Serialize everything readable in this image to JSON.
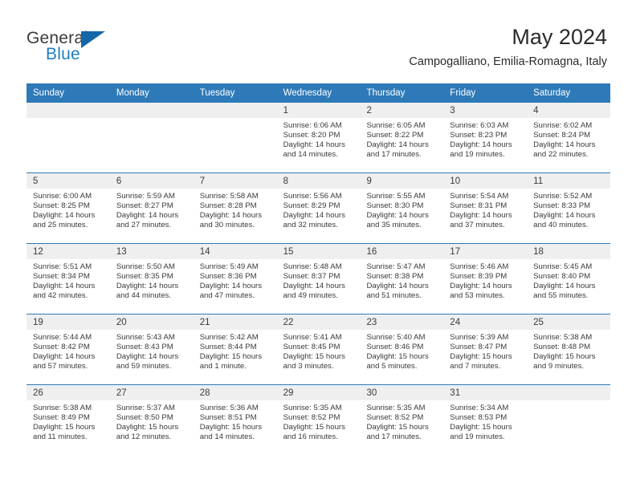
{
  "brand": {
    "name_part1": "General",
    "name_part2": "Blue",
    "colors": {
      "general": "#3b3b3b",
      "blue": "#1f7fc4",
      "flag": "#1566a8"
    }
  },
  "header": {
    "month_title": "May 2024",
    "location": "Campogalliano, Emilia-Romagna, Italy"
  },
  "calendar": {
    "header_color": "#2e7ab8",
    "day_band_color": "#efefef",
    "weekdays": [
      "Sunday",
      "Monday",
      "Tuesday",
      "Wednesday",
      "Thursday",
      "Friday",
      "Saturday"
    ],
    "weeks": [
      [
        {
          "day": "",
          "sunrise": "",
          "sunset": "",
          "daylight_line1": "",
          "daylight_line2": ""
        },
        {
          "day": "",
          "sunrise": "",
          "sunset": "",
          "daylight_line1": "",
          "daylight_line2": ""
        },
        {
          "day": "",
          "sunrise": "",
          "sunset": "",
          "daylight_line1": "",
          "daylight_line2": ""
        },
        {
          "day": "1",
          "sunrise": "Sunrise: 6:06 AM",
          "sunset": "Sunset: 8:20 PM",
          "daylight_line1": "Daylight: 14 hours",
          "daylight_line2": "and 14 minutes."
        },
        {
          "day": "2",
          "sunrise": "Sunrise: 6:05 AM",
          "sunset": "Sunset: 8:22 PM",
          "daylight_line1": "Daylight: 14 hours",
          "daylight_line2": "and 17 minutes."
        },
        {
          "day": "3",
          "sunrise": "Sunrise: 6:03 AM",
          "sunset": "Sunset: 8:23 PM",
          "daylight_line1": "Daylight: 14 hours",
          "daylight_line2": "and 19 minutes."
        },
        {
          "day": "4",
          "sunrise": "Sunrise: 6:02 AM",
          "sunset": "Sunset: 8:24 PM",
          "daylight_line1": "Daylight: 14 hours",
          "daylight_line2": "and 22 minutes."
        }
      ],
      [
        {
          "day": "5",
          "sunrise": "Sunrise: 6:00 AM",
          "sunset": "Sunset: 8:25 PM",
          "daylight_line1": "Daylight: 14 hours",
          "daylight_line2": "and 25 minutes."
        },
        {
          "day": "6",
          "sunrise": "Sunrise: 5:59 AM",
          "sunset": "Sunset: 8:27 PM",
          "daylight_line1": "Daylight: 14 hours",
          "daylight_line2": "and 27 minutes."
        },
        {
          "day": "7",
          "sunrise": "Sunrise: 5:58 AM",
          "sunset": "Sunset: 8:28 PM",
          "daylight_line1": "Daylight: 14 hours",
          "daylight_line2": "and 30 minutes."
        },
        {
          "day": "8",
          "sunrise": "Sunrise: 5:56 AM",
          "sunset": "Sunset: 8:29 PM",
          "daylight_line1": "Daylight: 14 hours",
          "daylight_line2": "and 32 minutes."
        },
        {
          "day": "9",
          "sunrise": "Sunrise: 5:55 AM",
          "sunset": "Sunset: 8:30 PM",
          "daylight_line1": "Daylight: 14 hours",
          "daylight_line2": "and 35 minutes."
        },
        {
          "day": "10",
          "sunrise": "Sunrise: 5:54 AM",
          "sunset": "Sunset: 8:31 PM",
          "daylight_line1": "Daylight: 14 hours",
          "daylight_line2": "and 37 minutes."
        },
        {
          "day": "11",
          "sunrise": "Sunrise: 5:52 AM",
          "sunset": "Sunset: 8:33 PM",
          "daylight_line1": "Daylight: 14 hours",
          "daylight_line2": "and 40 minutes."
        }
      ],
      [
        {
          "day": "12",
          "sunrise": "Sunrise: 5:51 AM",
          "sunset": "Sunset: 8:34 PM",
          "daylight_line1": "Daylight: 14 hours",
          "daylight_line2": "and 42 minutes."
        },
        {
          "day": "13",
          "sunrise": "Sunrise: 5:50 AM",
          "sunset": "Sunset: 8:35 PM",
          "daylight_line1": "Daylight: 14 hours",
          "daylight_line2": "and 44 minutes."
        },
        {
          "day": "14",
          "sunrise": "Sunrise: 5:49 AM",
          "sunset": "Sunset: 8:36 PM",
          "daylight_line1": "Daylight: 14 hours",
          "daylight_line2": "and 47 minutes."
        },
        {
          "day": "15",
          "sunrise": "Sunrise: 5:48 AM",
          "sunset": "Sunset: 8:37 PM",
          "daylight_line1": "Daylight: 14 hours",
          "daylight_line2": "and 49 minutes."
        },
        {
          "day": "16",
          "sunrise": "Sunrise: 5:47 AM",
          "sunset": "Sunset: 8:38 PM",
          "daylight_line1": "Daylight: 14 hours",
          "daylight_line2": "and 51 minutes."
        },
        {
          "day": "17",
          "sunrise": "Sunrise: 5:46 AM",
          "sunset": "Sunset: 8:39 PM",
          "daylight_line1": "Daylight: 14 hours",
          "daylight_line2": "and 53 minutes."
        },
        {
          "day": "18",
          "sunrise": "Sunrise: 5:45 AM",
          "sunset": "Sunset: 8:40 PM",
          "daylight_line1": "Daylight: 14 hours",
          "daylight_line2": "and 55 minutes."
        }
      ],
      [
        {
          "day": "19",
          "sunrise": "Sunrise: 5:44 AM",
          "sunset": "Sunset: 8:42 PM",
          "daylight_line1": "Daylight: 14 hours",
          "daylight_line2": "and 57 minutes."
        },
        {
          "day": "20",
          "sunrise": "Sunrise: 5:43 AM",
          "sunset": "Sunset: 8:43 PM",
          "daylight_line1": "Daylight: 14 hours",
          "daylight_line2": "and 59 minutes."
        },
        {
          "day": "21",
          "sunrise": "Sunrise: 5:42 AM",
          "sunset": "Sunset: 8:44 PM",
          "daylight_line1": "Daylight: 15 hours",
          "daylight_line2": "and 1 minute."
        },
        {
          "day": "22",
          "sunrise": "Sunrise: 5:41 AM",
          "sunset": "Sunset: 8:45 PM",
          "daylight_line1": "Daylight: 15 hours",
          "daylight_line2": "and 3 minutes."
        },
        {
          "day": "23",
          "sunrise": "Sunrise: 5:40 AM",
          "sunset": "Sunset: 8:46 PM",
          "daylight_line1": "Daylight: 15 hours",
          "daylight_line2": "and 5 minutes."
        },
        {
          "day": "24",
          "sunrise": "Sunrise: 5:39 AM",
          "sunset": "Sunset: 8:47 PM",
          "daylight_line1": "Daylight: 15 hours",
          "daylight_line2": "and 7 minutes."
        },
        {
          "day": "25",
          "sunrise": "Sunrise: 5:38 AM",
          "sunset": "Sunset: 8:48 PM",
          "daylight_line1": "Daylight: 15 hours",
          "daylight_line2": "and 9 minutes."
        }
      ],
      [
        {
          "day": "26",
          "sunrise": "Sunrise: 5:38 AM",
          "sunset": "Sunset: 8:49 PM",
          "daylight_line1": "Daylight: 15 hours",
          "daylight_line2": "and 11 minutes."
        },
        {
          "day": "27",
          "sunrise": "Sunrise: 5:37 AM",
          "sunset": "Sunset: 8:50 PM",
          "daylight_line1": "Daylight: 15 hours",
          "daylight_line2": "and 12 minutes."
        },
        {
          "day": "28",
          "sunrise": "Sunrise: 5:36 AM",
          "sunset": "Sunset: 8:51 PM",
          "daylight_line1": "Daylight: 15 hours",
          "daylight_line2": "and 14 minutes."
        },
        {
          "day": "29",
          "sunrise": "Sunrise: 5:35 AM",
          "sunset": "Sunset: 8:52 PM",
          "daylight_line1": "Daylight: 15 hours",
          "daylight_line2": "and 16 minutes."
        },
        {
          "day": "30",
          "sunrise": "Sunrise: 5:35 AM",
          "sunset": "Sunset: 8:52 PM",
          "daylight_line1": "Daylight: 15 hours",
          "daylight_line2": "and 17 minutes."
        },
        {
          "day": "31",
          "sunrise": "Sunrise: 5:34 AM",
          "sunset": "Sunset: 8:53 PM",
          "daylight_line1": "Daylight: 15 hours",
          "daylight_line2": "and 19 minutes."
        },
        {
          "day": "",
          "sunrise": "",
          "sunset": "",
          "daylight_line1": "",
          "daylight_line2": ""
        }
      ]
    ]
  }
}
